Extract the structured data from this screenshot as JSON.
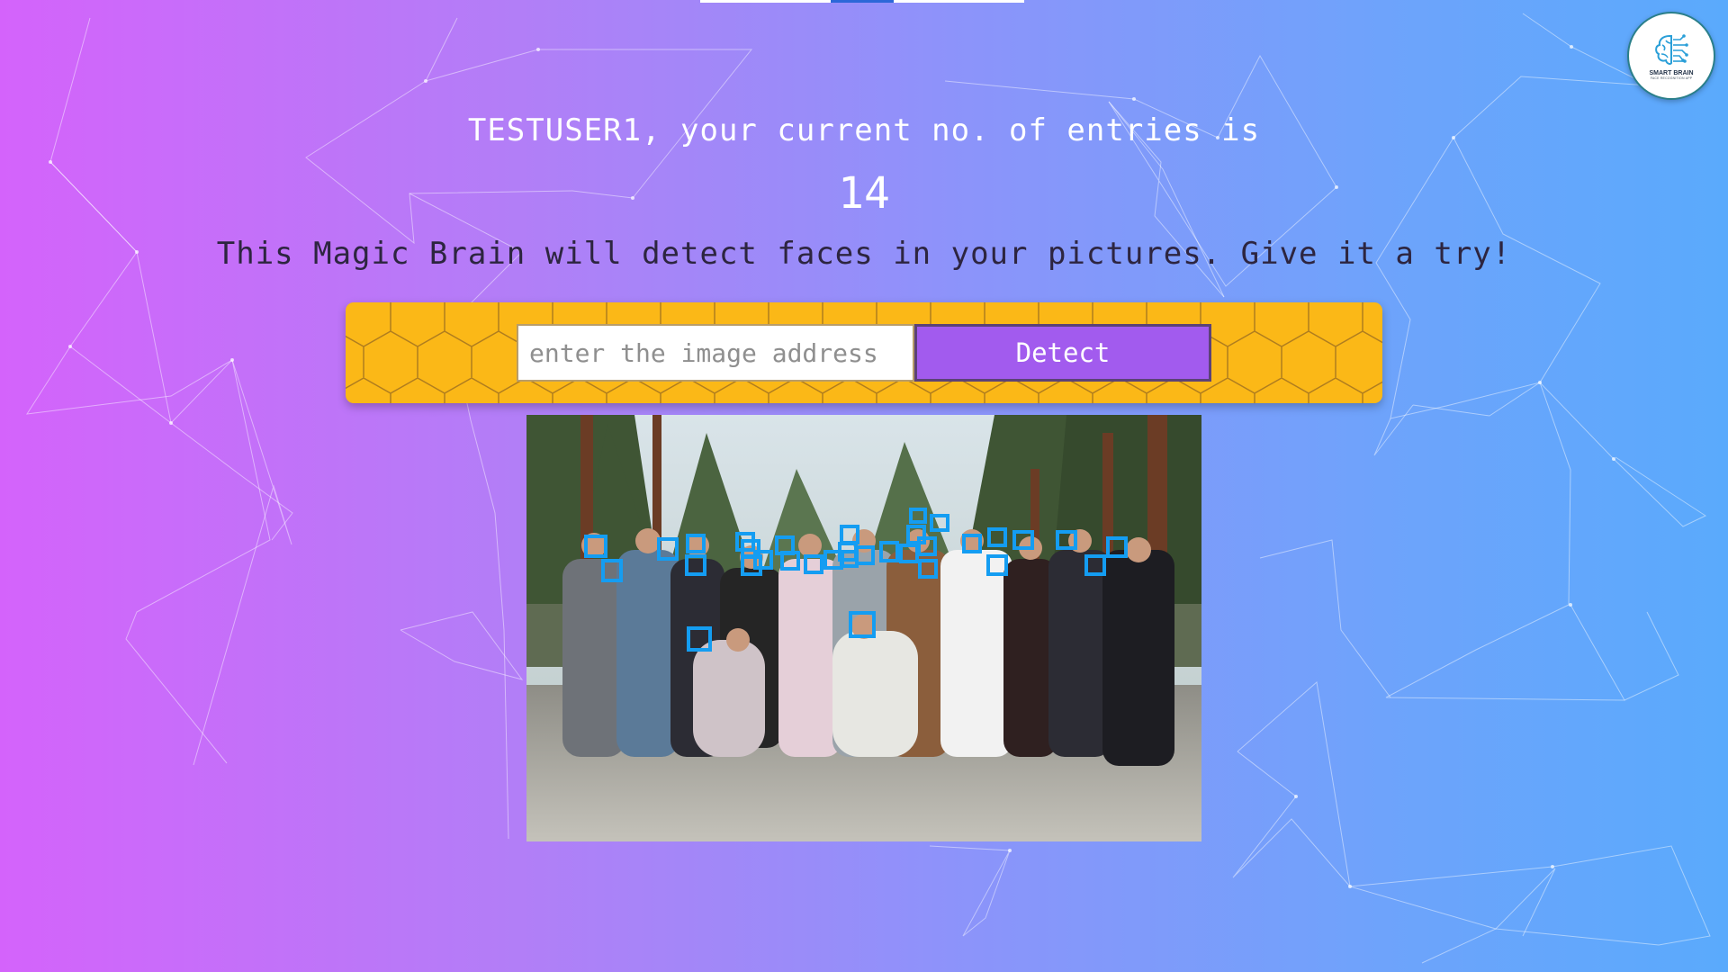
{
  "header": {
    "welcome": "TESTUSER1, your current no. of entries is",
    "entries": "14",
    "tagline": "This Magic Brain will detect faces in your pictures. Give it a try!"
  },
  "logo": {
    "title": "SMART BRAIN",
    "subtitle": "FACE RECOGNITION APP",
    "icon": "brain-circuit-icon"
  },
  "form": {
    "placeholder": "enter the image address",
    "value": "",
    "button_label": "Detect"
  },
  "image": {
    "description_icon": "group-photo",
    "face_count": 31
  },
  "colors": {
    "panel": "#fbb817",
    "button": "#a25bee",
    "face_box": "#149df2",
    "gradient_left": "#d463fb",
    "gradient_right": "#5aaafc",
    "tab_active": "#2c67d8"
  }
}
